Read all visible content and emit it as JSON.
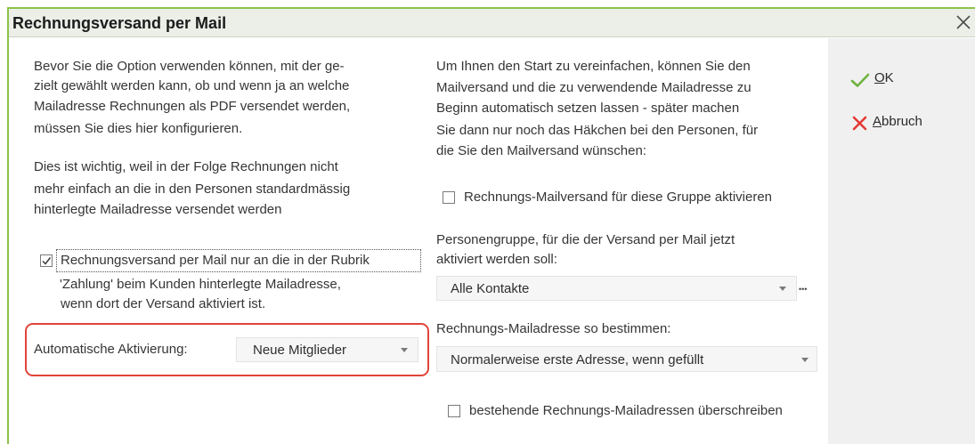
{
  "dialog": {
    "title": "Rechnungsversand per Mail"
  },
  "left": {
    "intro_lines": [
      "Bevor Sie die Option verwenden können, mit der ge-",
      "zielt gewählt werden kann, ob und wenn ja an welche",
      "Mailadresse Rechnungen als PDF versendet werden,",
      "müssen Sie dies hier konfigurieren."
    ],
    "note_lines": [
      "Dies ist wichtig, weil in der Folge Rechnungen nicht",
      "mehr einfach an die in den Personen standardmässig",
      "hinterlegte Mailadresse versendet werden"
    ],
    "rubrik_option": {
      "checked": true,
      "label_lines": [
        "Rechnungsversand per Mail nur an die in der Rubrik",
        "'Zahlung' beim Kunden hinterlegte Mailadresse,",
        "wenn dort der Versand aktiviert ist."
      ]
    },
    "auto_activation": {
      "label": "Automatische Aktivierung:",
      "value": "Neue Mitglieder"
    }
  },
  "right": {
    "intro_lines": [
      "Um Ihnen den Start zu vereinfachen, können Sie den",
      "Mailversand und die zu verwendende Mailadresse zu",
      "Beginn automatisch setzen lassen - später machen",
      "Sie dann nur noch das Häkchen bei den Personen, für",
      "die Sie den Mailversand wünschen:"
    ],
    "group_mailing": {
      "checked": false,
      "label": "Rechnungs-Mailversand für diese Gruppe aktivieren"
    },
    "person_group": {
      "label_lines": [
        "Personengruppe, für die der Versand per Mail jetzt",
        "aktiviert werden soll:"
      ],
      "value": "Alle Kontakte",
      "more_label": "•••"
    },
    "address_mode": {
      "label": "Rechnungs-Mailadresse so bestimmen:",
      "value": "Normalerweise erste Adresse, wenn gefüllt"
    },
    "overwrite": {
      "checked": false,
      "label": "bestehende Rechnungs-Mailadressen überschreiben"
    }
  },
  "actions": {
    "ok": {
      "label": "OK",
      "icon": "check-icon"
    },
    "cancel": {
      "label": "Abbruch",
      "icon": "cross-icon"
    }
  },
  "icons": {
    "close": "close-icon",
    "dropdown": "chevron-down-icon"
  },
  "colors": {
    "frame_green": "#8bc34a",
    "title_bar": "#ebefe8",
    "highlight_red": "#e0443a",
    "ok_green": "#6db33f",
    "cancel_red": "#e53935",
    "side_panel": "#f0f0f0"
  }
}
